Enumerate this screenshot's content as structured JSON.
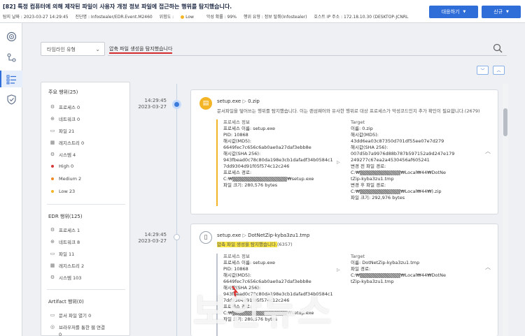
{
  "header": {
    "title": "[82] 특정 컴퓨터에 의해 제작된 파일이 사용자 개정 정보 파일에 접근하는 행위를 탐지했습니다.",
    "meta": {
      "detect_date": "탐지 날짜 : 2023-03-27 14:29:45",
      "rule": "진단명 : Infostealer/EDR.Event.M2460",
      "risk_label": "위험도 :",
      "risk_value": "Low",
      "malicious": "악성 확률 : 99%",
      "behavior": "행위 유형 : 정보 탈취(Infostealer)",
      "host": "호스트 IP 주소 : 172.18.10.30 (DESKTOP-JCNRL"
    },
    "respond_button": "대응하기",
    "new_button": "신규"
  },
  "search": {
    "select_label": "타임라인 유형",
    "query": "압축 파일 생성을 탐지했습니다"
  },
  "filters": {
    "main": {
      "heading": "주요 행위(25)",
      "items": [
        {
          "icon": "gear-icon",
          "label": "프로세스 0"
        },
        {
          "icon": "network-icon",
          "label": "네트워크 0"
        },
        {
          "icon": "file-icon",
          "label": "파일 21"
        },
        {
          "icon": "registry-icon",
          "label": "레지스트리 0"
        },
        {
          "icon": "system-icon",
          "label": "시스템 4"
        },
        {
          "icon": "dot-red",
          "label": "High 0"
        },
        {
          "icon": "dot-orange",
          "label": "Medium 2"
        },
        {
          "icon": "dot-yellow",
          "label": "Low 23"
        }
      ]
    },
    "edr": {
      "heading": "EDR 행위(125)",
      "items": [
        {
          "icon": "gear-icon",
          "label": "프로세스 1"
        },
        {
          "icon": "network-icon",
          "label": "네트워크 8"
        },
        {
          "icon": "file-icon",
          "label": "파일 11"
        },
        {
          "icon": "registry-icon",
          "label": "레지스트리 2"
        },
        {
          "icon": "system-icon",
          "label": "시스템 103"
        }
      ]
    },
    "artifact": {
      "heading": "Artifact 행위(0)",
      "items": [
        {
          "icon": "file-icon",
          "label": "문서 파일 열기 0"
        },
        {
          "icon": "browser-icon",
          "label": "브라우저를 통한 웹 연결"
        },
        {
          "icon": "info-icon",
          "label": "0"
        }
      ]
    }
  },
  "events": [
    {
      "time": "14:29:45",
      "date": "2023-03-27",
      "title_proc": "setup.exe",
      "title_target": "0.zip",
      "desc": "문서파일을 덮어쓰는 행위를 탐지했습니다. 이는 랜섬웨어와 유사한 행위로 대상 프로세스가 악성코드인지 추가 확인이 필요합니다.(2679)",
      "process_header": "프로세스 정보",
      "process_lines": [
        "프로세스 이름: setup.exe",
        "PID: 10868",
        "해시값(MD5):",
        "6649fec7c656c6ab0ae0a27daf3ebb8e",
        "해시값(SHA 256):",
        "943fbead0c78c80da198e3cb1dafadf34b0584c1",
        "7dd9304d91f05f574c12c246",
        "프로세스 경로:"
      ],
      "process_path_prefix": "C:₩",
      "process_path_suffix": "₩setup.exe",
      "process_size": "파일 크기: 280,576 bytes",
      "target_header": "Target",
      "target_lines": [
        "이름: 0.zip",
        "해시값(MD5):",
        "43dd6ea03c87350d701df55ee07e7d279",
        "해시값(SHA 256):",
        "007d5b7a9976d88b787b597152a9d247e179",
        "249277c67ea2a4530456af605241",
        "변경 전 파일 경로:"
      ],
      "target_path1_prefix": "C:₩",
      "target_path1_suffix": "₩Local₩44₩DotNe",
      "target_path1_cont": "tZip-kyba3zu1.tmp",
      "target_changed_label": "변경 후 파일 경로:",
      "target_path2_prefix": "C:₩",
      "target_path2_suffix": "₩Local₩44₩).zip",
      "target_size": "파일 크기: 292,976 bytes"
    },
    {
      "time": "14:29:45",
      "date": "2023-03-27",
      "title_proc": "setup.exe",
      "title_target": "DotNetZip-kyba3zu1.tmp",
      "desc_highlight": "압축 파일 생성을 탐지했습니다.",
      "desc_code": "(6357)",
      "process_header": "프로세스 정보",
      "process_lines": [
        "프로세스 이름: setup.exe",
        "PID: 10868",
        "해시값(MD5):",
        "6649fec7c656c6ab0ae0a27daf3ebb8e",
        "해시값(SHA 256):",
        "943fbead0c78c80da198e3cb1dafadf34b0584c1",
        "7dd9304d91f05f574c12c246",
        "프로세스 경로:"
      ],
      "process_path_prefix": "C:₩",
      "process_path_suffix": "₩setup.exe",
      "process_size": "파일 크기: 280,576 bytes",
      "target_header": "Target",
      "target_lines": [
        "이름: DotNetZip-kyba3zu1.tmp",
        "파일 경로:"
      ],
      "target_path1_prefix": "C:₩",
      "target_path1_suffix": "₩Local₩44₩DotNe",
      "target_path1_cont": "tZip-kyba3zu1.tmp"
    }
  ],
  "watermark": "보안뉴스",
  "colors": {
    "accent": "#2f6dd9",
    "highlight": "#f5e342",
    "low": "#f3b526",
    "underline": "#d42c2c"
  }
}
